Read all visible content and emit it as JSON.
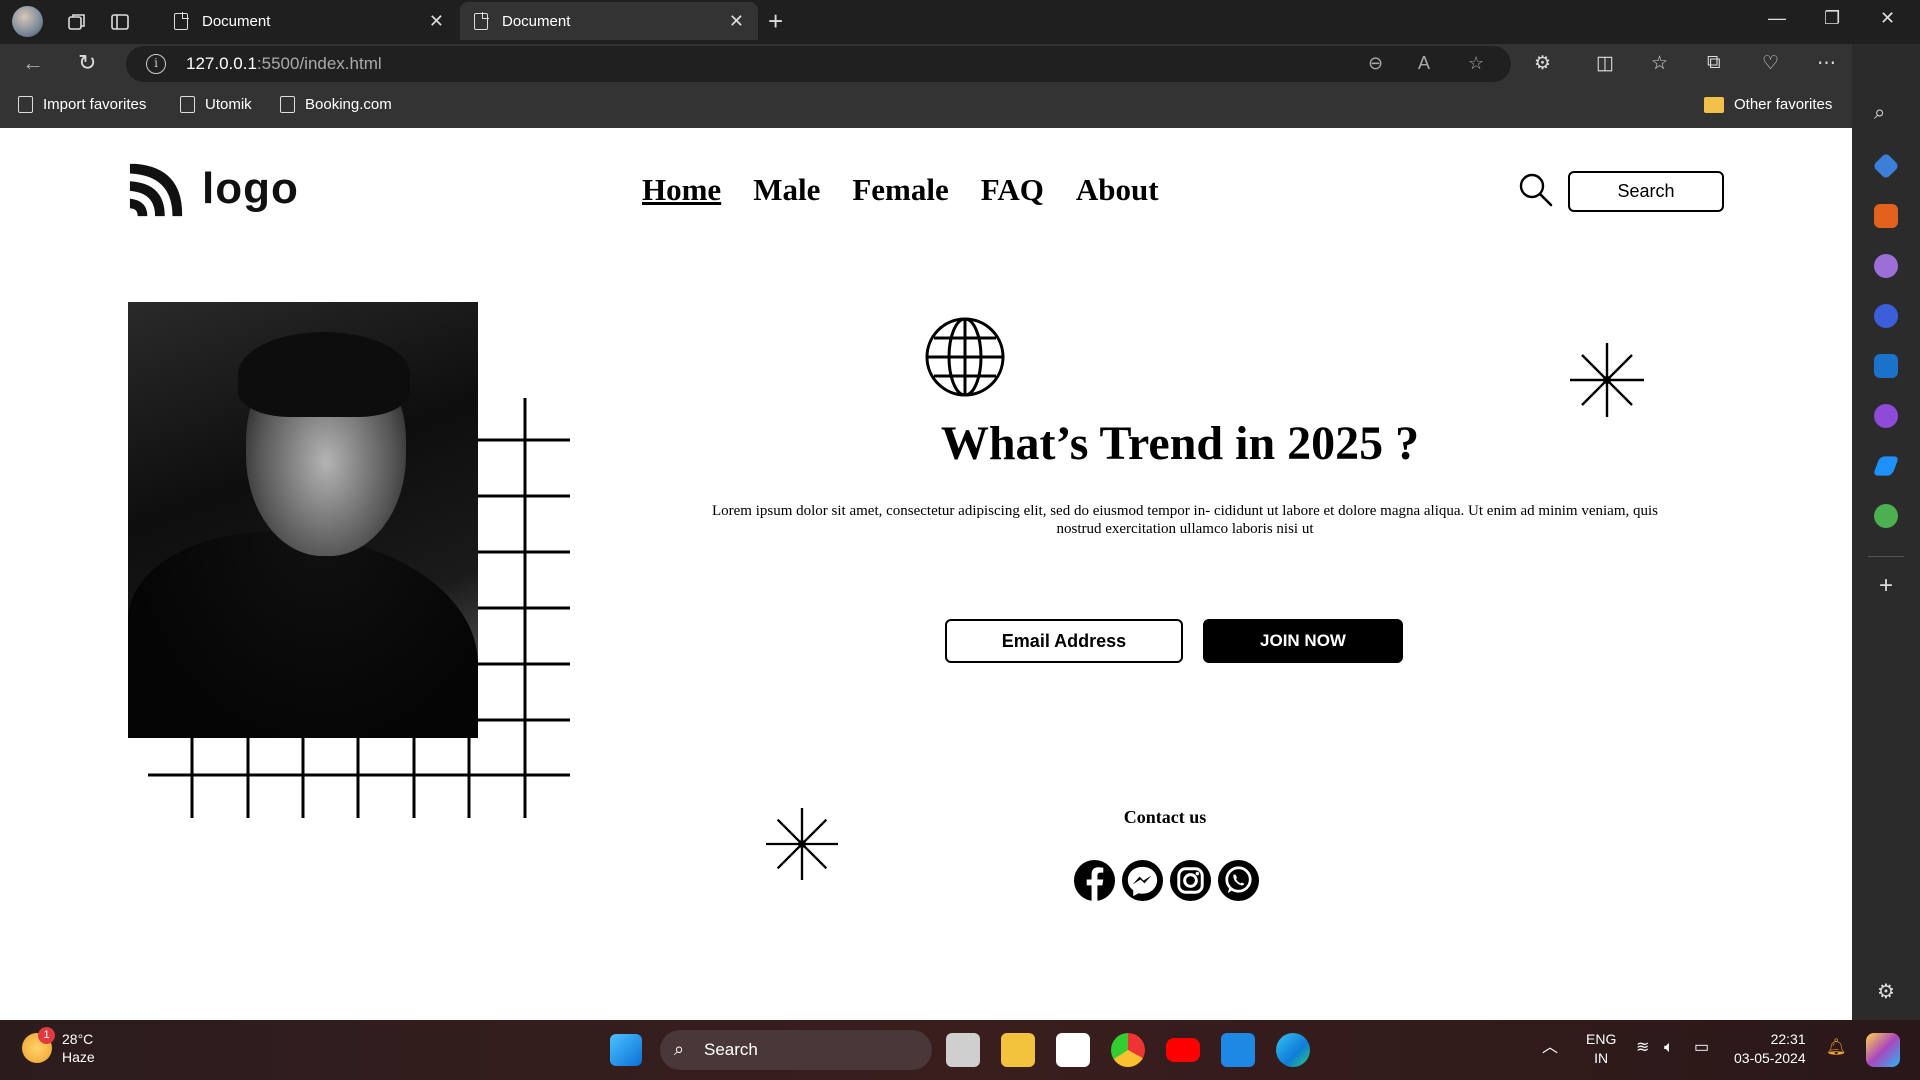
{
  "browser": {
    "tabs": [
      {
        "title": "Document"
      },
      {
        "title": "Document"
      }
    ],
    "url_host": "127.0.0.1",
    "url_path": ":5500/index.html",
    "favorites": [
      {
        "label": "Import favorites"
      },
      {
        "label": "Utomik"
      },
      {
        "label": "Booking.com"
      }
    ],
    "other_favorites": "Other favorites"
  },
  "page": {
    "logo_text": "logo",
    "nav": [
      {
        "label": "Home",
        "active": true
      },
      {
        "label": "Male"
      },
      {
        "label": "Female"
      },
      {
        "label": "FAQ"
      },
      {
        "label": "About"
      }
    ],
    "search_label": "Search",
    "headline": "What’s Trend in 2025 ?",
    "body_text": "Lorem ipsum dolor sit amet, consectetur adipiscing elit, sed do eiusmod tempor in- cididunt ut labore et dolore magna aliqua. Ut enim ad minim veniam, quis nostrud exercitation ullamco laboris nisi ut",
    "email_button": "Email Address",
    "join_button": "JOIN NOW",
    "contact_heading": "Contact us",
    "socials": [
      "facebook-icon",
      "messenger-icon",
      "instagram-icon",
      "whatsapp-icon"
    ]
  },
  "taskbar": {
    "weather_temp": "28°C",
    "weather_desc": "Haze",
    "weather_badge": "1",
    "search_label": "Search",
    "lang_top": "ENG",
    "lang_bottom": "IN",
    "time": "22:31",
    "date": "03-05-2024"
  },
  "colors": {
    "chrome_dark": "#1f1f1f",
    "chrome_mid": "#333333",
    "page_bg": "#ffffff",
    "ink": "#000000"
  }
}
